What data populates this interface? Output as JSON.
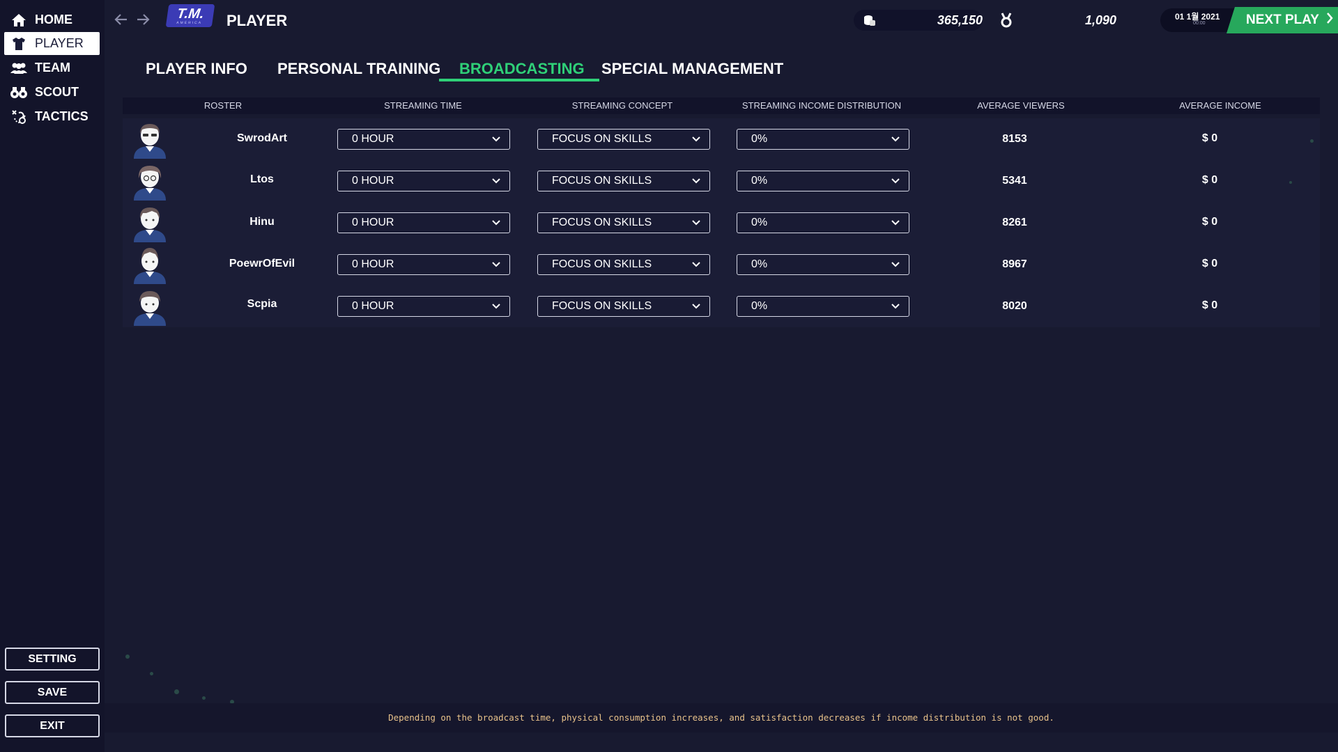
{
  "sidebar": {
    "nav": [
      {
        "label": "HOME",
        "icon": "home-icon"
      },
      {
        "label": "PLAYER",
        "icon": "jersey-icon",
        "active": true
      },
      {
        "label": "TEAM",
        "icon": "team-icon"
      },
      {
        "label": "SCOUT",
        "icon": "binoculars-icon"
      },
      {
        "label": "TACTICS",
        "icon": "tactics-icon"
      }
    ],
    "buttons": {
      "setting": "SETTING",
      "save": "SAVE",
      "exit": "EXIT"
    }
  },
  "topbar": {
    "logo": "T.M.",
    "logo_sub": "AMERICA",
    "title": "PLAYER",
    "money": "365,150",
    "fans": "1,090",
    "date": "01 1월 2021",
    "time": "00:00",
    "next_play": "NEXT PLAY"
  },
  "tabs": [
    "PLAYER INFO",
    "PERSONAL TRAINING",
    "BROADCASTING",
    "SPECIAL MANAGEMENT"
  ],
  "active_tab": "BROADCASTING",
  "table": {
    "headers": [
      "ROSTER",
      "STREAMING TIME",
      "STREAMING CONCEPT",
      "STREAMING INCOME DISTRIBUTION",
      "AVERAGE VIEWERS",
      "AVERAGE INCOME"
    ],
    "rows": [
      {
        "name": "SwrodArt",
        "time": "0 HOUR",
        "concept": "FOCUS ON SKILLS",
        "distribution": "0%",
        "viewers": "8153",
        "income": "$ 0"
      },
      {
        "name": "Ltos",
        "time": "0 HOUR",
        "concept": "FOCUS ON SKILLS",
        "distribution": "0%",
        "viewers": "5341",
        "income": "$ 0"
      },
      {
        "name": "Hinu",
        "time": "0 HOUR",
        "concept": "FOCUS ON SKILLS",
        "distribution": "0%",
        "viewers": "8261",
        "income": "$ 0"
      },
      {
        "name": "PoewrOfEvil",
        "time": "0 HOUR",
        "concept": "FOCUS ON SKILLS",
        "distribution": "0%",
        "viewers": "8967",
        "income": "$ 0"
      },
      {
        "name": "Scpia",
        "time": "0 HOUR",
        "concept": "FOCUS ON SKILLS",
        "distribution": "0%",
        "viewers": "8020",
        "income": "$ 0"
      }
    ]
  },
  "footer_note": "Depending on the broadcast time, physical consumption increases, and satisfaction decreases if income distribution is not good.",
  "colors": {
    "accent": "#2fd078",
    "next_play": "#27a85c",
    "background": "#181a30",
    "sidebar": "#13142a",
    "note": "#e8c28a"
  }
}
